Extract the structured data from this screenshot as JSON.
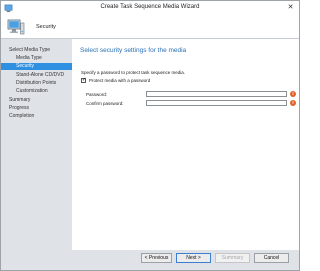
{
  "window": {
    "title": "Create Task Sequence Media Wizard",
    "close_glyph": "✕"
  },
  "header": {
    "title": "Security"
  },
  "nav": {
    "items": [
      {
        "label": "Select Media Type",
        "level": 1,
        "selected": false
      },
      {
        "label": "Media Type",
        "level": 2,
        "selected": false
      },
      {
        "label": "Security",
        "level": 2,
        "selected": true
      },
      {
        "label": "Stand-Alone CD/DVD",
        "level": 2,
        "selected": false
      },
      {
        "label": "Distribution Points",
        "level": 2,
        "selected": false
      },
      {
        "label": "Customization",
        "level": 2,
        "selected": false
      },
      {
        "label": "Summary",
        "level": 1,
        "selected": false
      },
      {
        "label": "Progress",
        "level": 1,
        "selected": false
      },
      {
        "label": "Completion",
        "level": 1,
        "selected": false
      }
    ]
  },
  "main": {
    "title": "Select security settings for the media",
    "instruction": "Specify a password to protect task sequence media.",
    "protect_checkbox": {
      "label": "Protect media with a password",
      "checked": true,
      "mark": "✓"
    },
    "password": {
      "label": "Password:",
      "value": ""
    },
    "confirm_password": {
      "label": "Confirm password:",
      "value": ""
    },
    "error_glyph": "!"
  },
  "footer": {
    "previous": "< Previous",
    "next": "Next >",
    "summary": "Summary",
    "cancel": "Cancel"
  },
  "colors": {
    "selected_nav": "#2f8fe0",
    "title_blue": "#2a6fb5",
    "error": "#e0622b"
  }
}
